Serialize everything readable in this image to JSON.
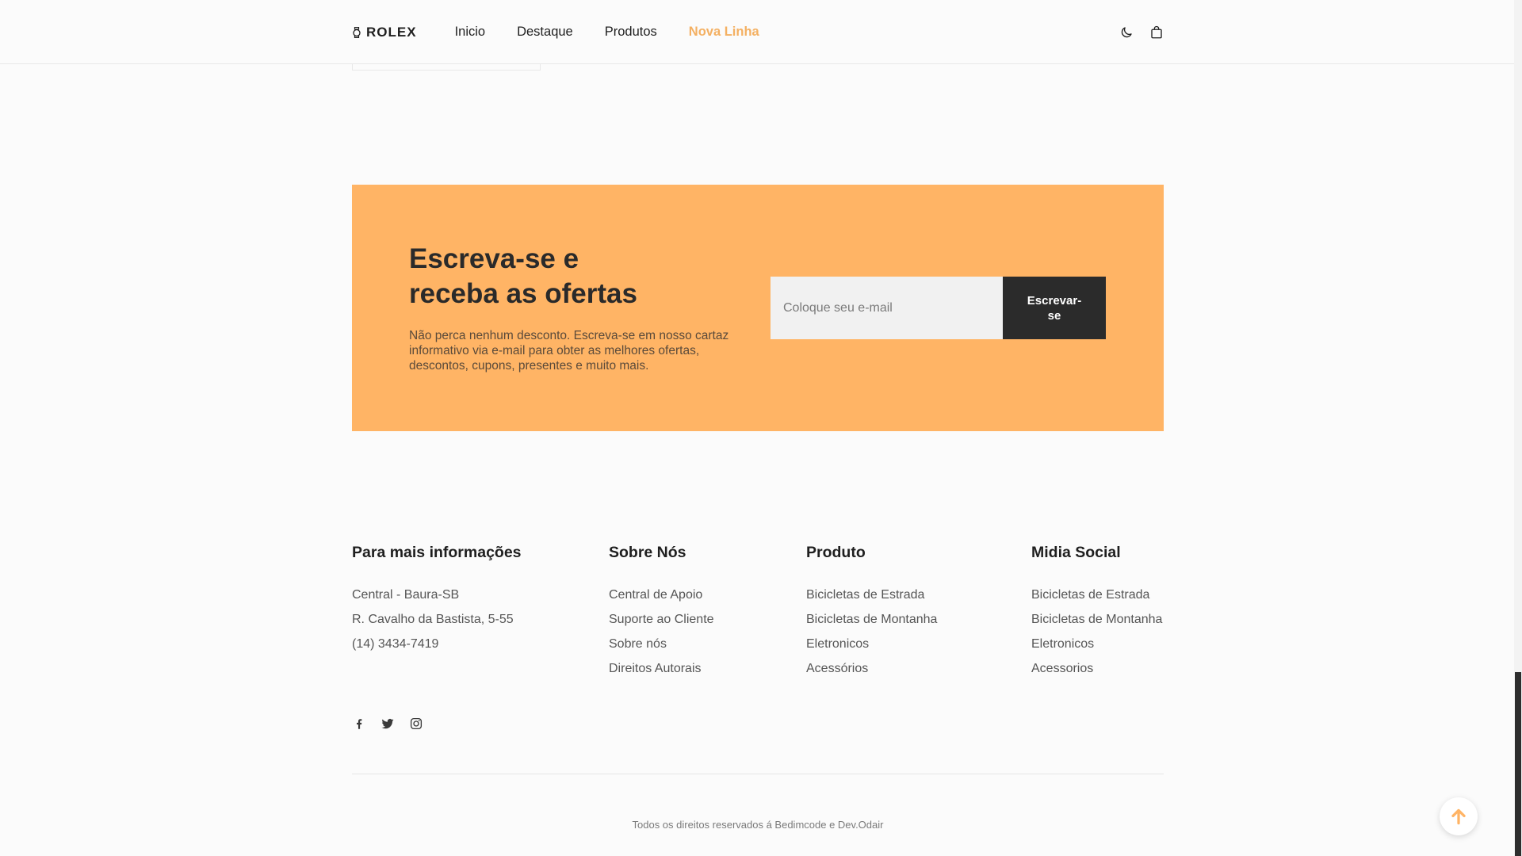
{
  "header": {
    "logo": "ROLEX",
    "nav": [
      {
        "label": "Inicio",
        "active": false
      },
      {
        "label": "Destaque",
        "active": false
      },
      {
        "label": "Produtos",
        "active": false
      },
      {
        "label": "Nova Linha",
        "active": true
      }
    ],
    "icons": [
      "moon-icon",
      "shopping-bag-icon"
    ]
  },
  "newsletter": {
    "title": "Escreva-se e\nreceba as ofertas",
    "description": "Não perca nenhum desconto. Escreva-se em nosso cartaz informativo via e-mail para obter as melhores ofertas, descontos, cupons, presentes e muito mais.",
    "input_placeholder": "Coloque seu e-mail",
    "button_label": "Escrevar-\nse"
  },
  "footer": {
    "columns": [
      {
        "title": "Para mais informações",
        "items": [
          "Central - Baura-SB",
          "R. Cavalho da Bastista, 5-55",
          "(14) 3434-7419"
        ]
      },
      {
        "title": "Sobre Nós",
        "items": [
          "Central de Apoio",
          "Suporte ao Cliente",
          "Sobre nós",
          "Direitos Autorais"
        ]
      },
      {
        "title": "Produto",
        "items": [
          "Bicicletas de Estrada",
          "Bicicletas de Montanha",
          "Eletronicos",
          "Acessórios"
        ]
      },
      {
        "title": "Midia Social",
        "items": [
          "Bicicletas de Estrada",
          "Bicicletas de Montanha",
          "Eletronicos",
          "Acessorios"
        ]
      }
    ],
    "social_icons": [
      "facebook-icon",
      "twitter-icon",
      "instagram-icon"
    ],
    "copyright": "Todos os direitos reservados á Bedimcode e Dev.Odair"
  },
  "colors": {
    "accent": "#ffb465",
    "nav_active": "#f4b062",
    "button_dark": "#2b2b2b"
  }
}
